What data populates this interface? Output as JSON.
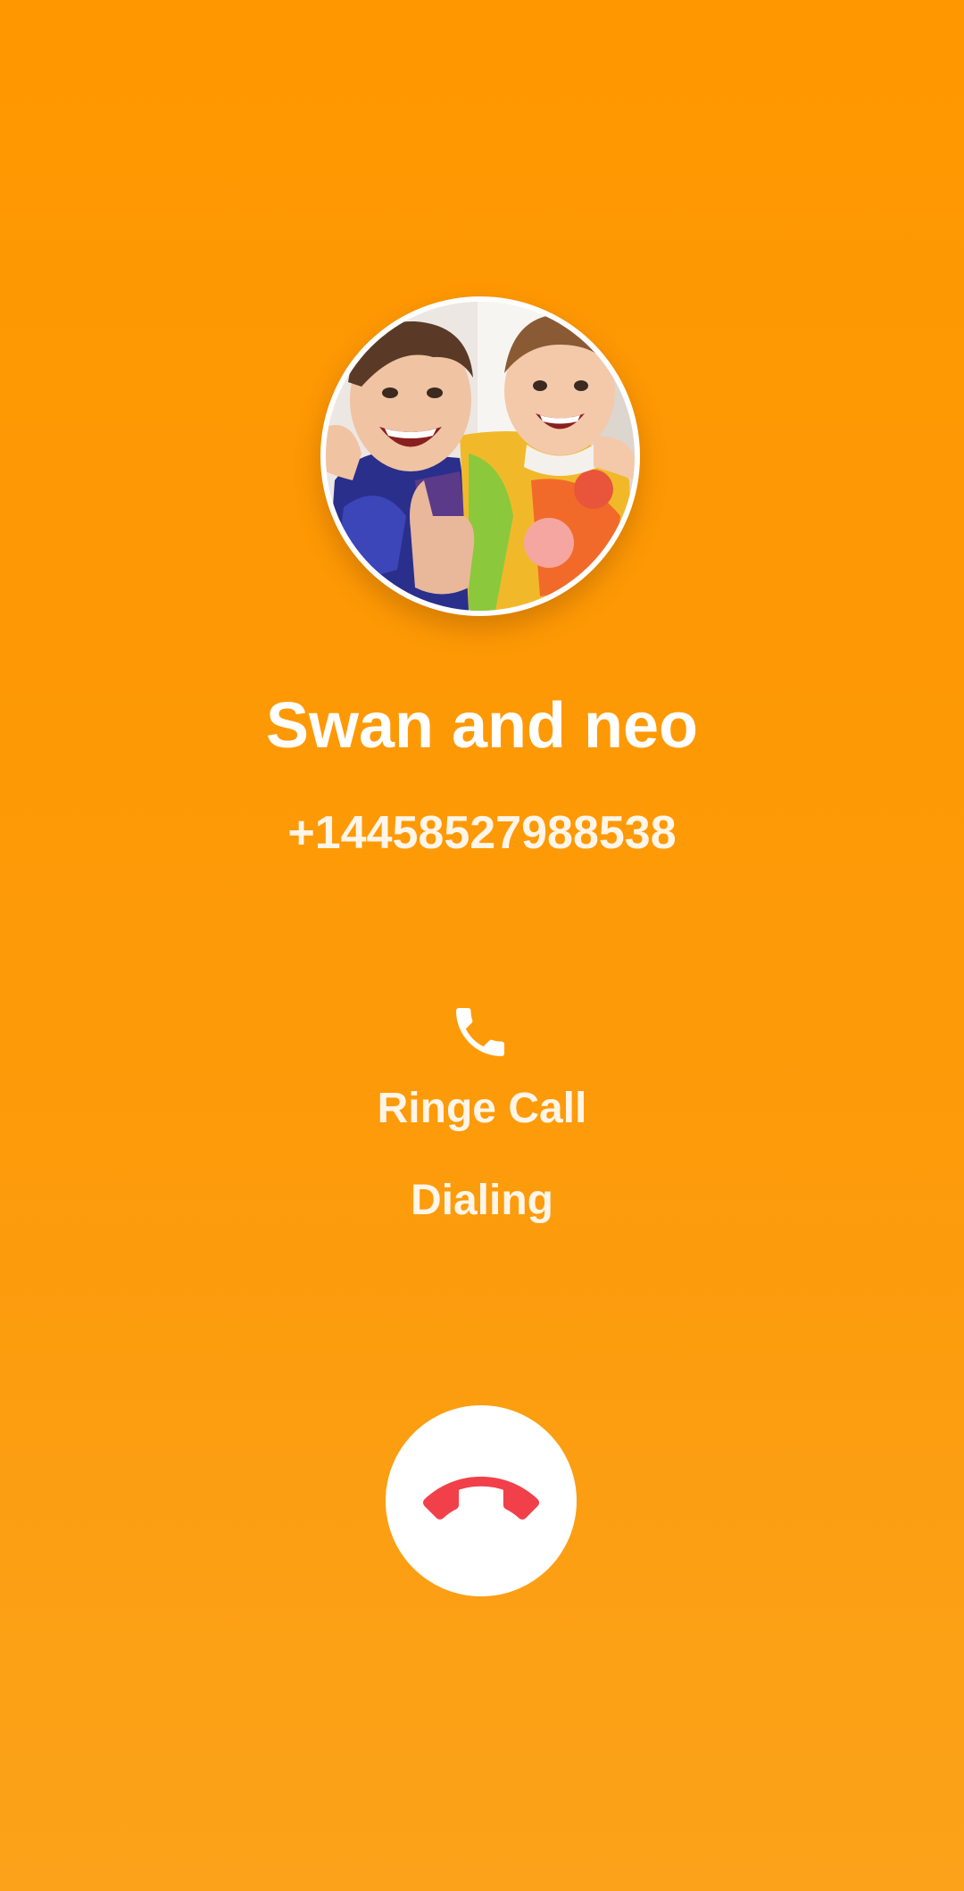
{
  "contact": {
    "name": "Swan and neo",
    "number": "+14458527988538",
    "avatar_icon": "contact-photo"
  },
  "call": {
    "label": "Ringe Call",
    "status": "Dialing",
    "call_icon": "phone-icon",
    "end_icon": "hang-up-icon"
  },
  "colors": {
    "background_top": "#ff9700",
    "background_bottom": "#fba21a",
    "text": "#ffffff",
    "end_button": "#ffffff",
    "end_icon": "#f2404a"
  }
}
